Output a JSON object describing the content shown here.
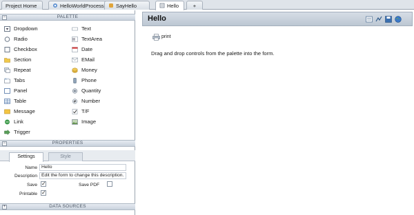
{
  "tabs": [
    {
      "label": "Project Home",
      "icon": "none",
      "active": false
    },
    {
      "label": "HelloWorldProcess",
      "icon": "process-icon",
      "active": false
    },
    {
      "label": "SayHello",
      "icon": "activity-icon",
      "active": false
    },
    {
      "label": "Hello",
      "icon": "form-icon",
      "active": true
    },
    {
      "label": "+",
      "icon": "none",
      "active": false
    }
  ],
  "palette": {
    "title": "PALETTE",
    "left_items": [
      "Dropdown",
      "Radio",
      "Checkbox",
      "Section",
      "Repeat",
      "Tabs",
      "Panel",
      "Table",
      "Message",
      "Link",
      "Trigger"
    ],
    "right_items": [
      "Text",
      "TextArea",
      "Date",
      "EMail",
      "Money",
      "Phone",
      "Quantity",
      "Number",
      "T/F",
      "Image"
    ]
  },
  "properties": {
    "title": "PROPERTIES",
    "tabs": [
      "Settings",
      "Style"
    ],
    "name_label": "Name",
    "name_value": "Hello",
    "description_label": "Description",
    "description_value": "Edit the form to change this description.",
    "save_label": "Save",
    "save_checked": true,
    "save_pdf_label": "Save PDF",
    "save_pdf_checked": false,
    "printable_label": "Printable",
    "printable_checked": true
  },
  "data_sources": {
    "title": "DATA SOURCES"
  },
  "form": {
    "title": "Hello",
    "print_label": "print",
    "message": "Drag and drop controls from the palette into the form."
  },
  "toolbar_icons": [
    "properties-icon",
    "flow-icon",
    "save-icon",
    "globe-icon"
  ],
  "colors": {
    "header_bg": "#c9d2dd",
    "border": "#9aa4b0",
    "accent": "#3a6fb0"
  }
}
